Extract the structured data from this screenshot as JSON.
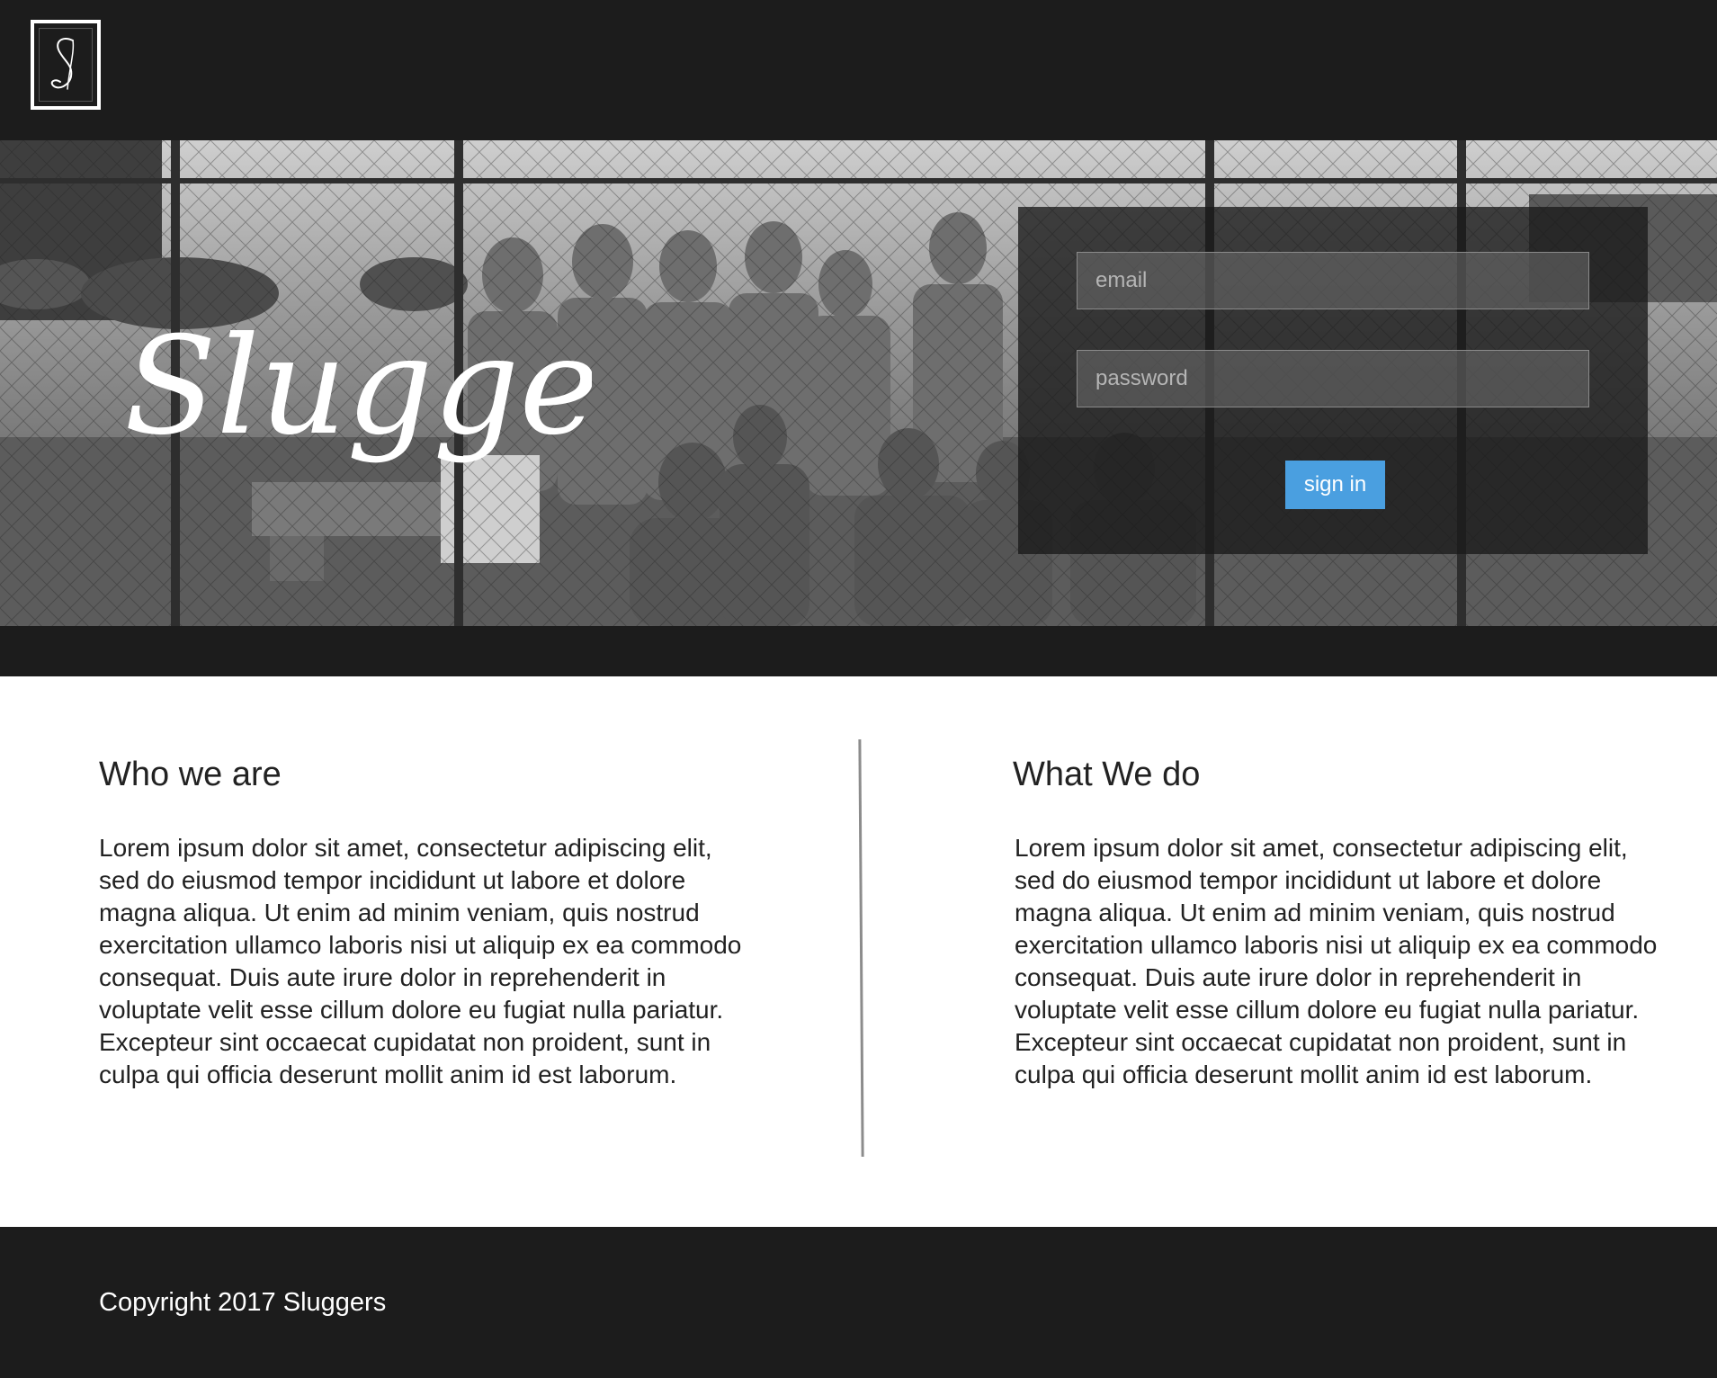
{
  "brand": {
    "logo_letter": "S",
    "hero_title": "Sluggers"
  },
  "login": {
    "email_placeholder": "email",
    "password_placeholder": "password",
    "signin_label": "sign in"
  },
  "sections": [
    {
      "heading": "Who we are",
      "body": "Lorem ipsum dolor sit amet, consectetur adipiscing elit, sed do eiusmod tempor incididunt ut labore et dolore magna aliqua. Ut enim ad minim veniam, quis nostrud exercitation ullamco laboris nisi ut aliquip ex ea commodo consequat. Duis aute irure dolor in reprehenderit in voluptate velit esse cillum dolore eu fugiat nulla pariatur. Excepteur sint occaecat cupidatat non proident, sunt in culpa qui officia deserunt mollit anim id est laborum."
    },
    {
      "heading": "What We do",
      "body": "Lorem ipsum dolor sit amet, consectetur adipiscing elit, sed do eiusmod tempor incididunt ut labore et dolore magna aliqua. Ut enim ad minim veniam, quis nostrud exercitation ullamco laboris nisi ut aliquip ex ea commodo consequat. Duis aute irure dolor in reprehenderit in voluptate velit esse cillum dolore eu fugiat nulla pariatur. Excepteur sint occaecat cupidatat non proident, sunt in culpa qui officia deserunt mollit anim id est laborum."
    }
  ],
  "footer": {
    "copyright": "Copyright 2017 Sluggers"
  },
  "colors": {
    "header_bg": "#1c1c1c",
    "accent_button": "#4a9fe0",
    "divider": "#8c8c8c"
  }
}
